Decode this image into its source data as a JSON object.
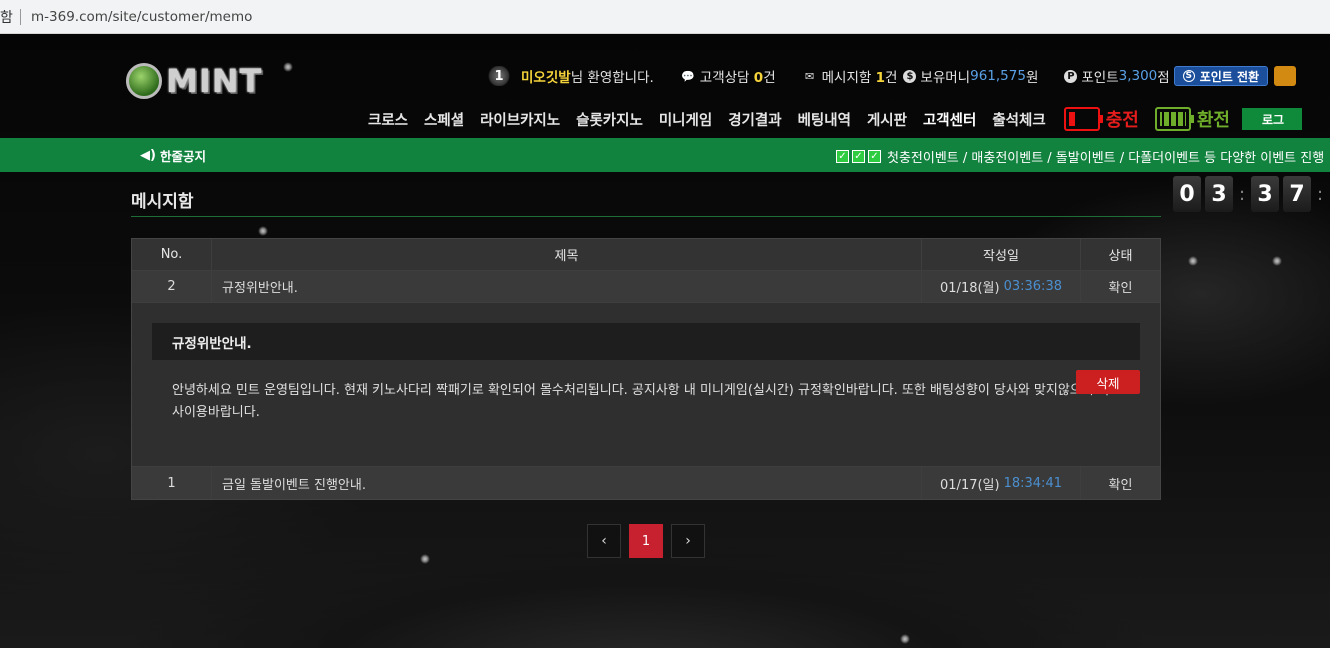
{
  "browser": {
    "tab_fragment": "함",
    "url": "m-369.com/site/customer/memo"
  },
  "header": {
    "logo_text": "MINT",
    "level": "1",
    "username": "미오깃발",
    "welcome_suffix": "님 환영합니다.",
    "consult_label": "고객상담 ",
    "consult_count": "0",
    "consult_unit": "건",
    "message_label": "메시지함 ",
    "message_count": "1",
    "message_unit": "건",
    "money_label": "보유머니 ",
    "money_value": "961,575",
    "money_unit": "원",
    "point_label": "포인트 ",
    "point_value": "3,300",
    "point_unit": "점",
    "point_convert_label": "포인트 전환"
  },
  "nav": {
    "items": [
      "크로스",
      "스페셜",
      "라이브카지노",
      "슬롯카지노",
      "미니게임",
      "경기결과",
      "베팅내역",
      "게시판",
      "고객센터",
      "출석체크"
    ],
    "charge_label": "충전",
    "exchange_label": "환전",
    "login_label": "로그"
  },
  "notice": {
    "label": "한줄공지",
    "ticker": "첫충전이벤트 / 매충전이벤트 / 돌발이벤트 / 다폴더이벤트 등 다양한 이벤트 진행"
  },
  "page": {
    "title": "메시지함"
  },
  "clock": {
    "digits": [
      "0",
      "3",
      "3",
      "7"
    ]
  },
  "table": {
    "headers": {
      "no": "No.",
      "title": "제목",
      "date": "작성일",
      "state": "상태"
    },
    "rows": [
      {
        "no": "2",
        "title": "규정위반안내.",
        "date": "01/18(월)",
        "time": "03:36:38",
        "state": "확인"
      },
      {
        "no": "1",
        "title": "금일 돌발이벤트 진행안내.",
        "date": "01/17(일)",
        "time": "18:34:41",
        "state": "확인"
      }
    ],
    "detail": {
      "title": "규정위반안내.",
      "body": "안녕하세요 민트 운영팀입니다. 현재 키노사다리 짝패기로 확인되어 몰수처리됩니다. 공지사항 내 미니게임(실시간) 규정확인바랍니다. 또한 배팅성향이 당사와 맞지않으니 타사이용바랍니다.",
      "delete_label": "삭제"
    }
  },
  "pager": {
    "prev": "‹",
    "current": "1",
    "next": "›"
  },
  "colors": {
    "accent_green": "#12823f",
    "username_yellow": "#f5d33a",
    "value_blue": "#5aa0e6",
    "charge_red": "#e51c1c",
    "exchange_green": "#6fae2a",
    "delete_red": "#cc1f1f",
    "pager_active": "#c7212f"
  }
}
